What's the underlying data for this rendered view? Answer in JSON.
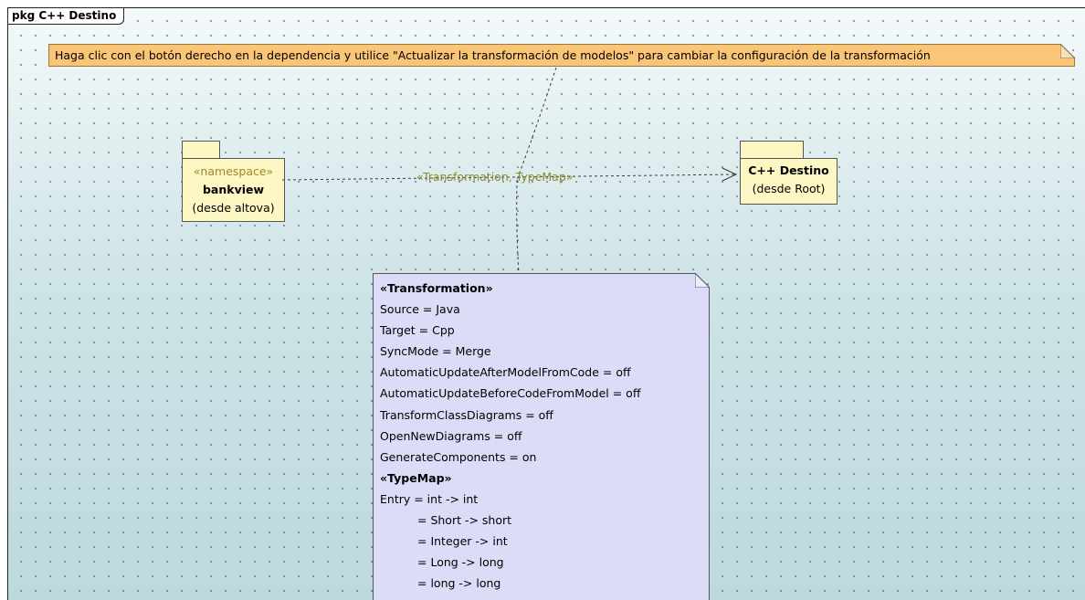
{
  "frame": {
    "title": "pkg C++ Destino"
  },
  "hint_note": {
    "text": "Haga clic con el botón derecho en la dependencia y utilice \"Actualizar la transformación de modelos\" para cambiar la configuración de la transformación"
  },
  "source_package": {
    "stereotype": "«namespace»",
    "name": "bankview",
    "origin": "(desde altova)"
  },
  "target_package": {
    "name": "C++ Destino",
    "origin": "(desde Root)"
  },
  "dependency": {
    "label": "«Transformation, TypeMap»"
  },
  "transformation_note": {
    "transformation_header": "«Transformation»",
    "properties": [
      "Source = Java",
      "Target = Cpp",
      "SyncMode = Merge",
      "AutomaticUpdateAfterModelFromCode = off",
      "AutomaticUpdateBeforeCodeFromModel = off",
      "TransformClassDiagrams = off",
      "OpenNewDiagrams = off",
      "GenerateComponents = on"
    ],
    "typemap_header": "«TypeMap»",
    "entries": [
      "Entry = int -> int",
      "= Short -> short",
      "= Integer -> int",
      "= Long -> long",
      "= long -> long"
    ]
  },
  "colors": {
    "canvas": "#cfe3e6",
    "hint_note": "#fbc577",
    "package": "#fdf7c4",
    "transformation_note": "#dcdcf8",
    "dependency_label": "#8c8c2a"
  }
}
